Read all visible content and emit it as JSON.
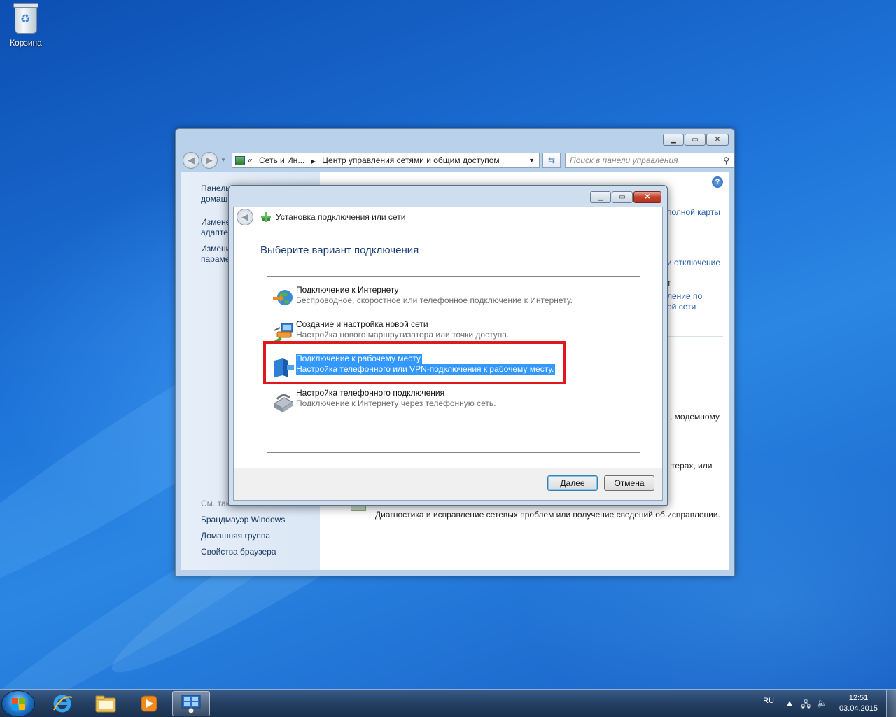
{
  "desktop": {
    "recycle_bin_label": "Корзина"
  },
  "control_panel": {
    "breadcrumb_chevron": "«",
    "breadcrumb_1": "Сеть и Ин...",
    "breadcrumb_arrow": "▶",
    "breadcrumb_2": "Центр управления сетями и общим доступом",
    "search_placeholder": "Поиск в панели управления",
    "left_items": [
      {
        "line1": "Панель",
        "line2": "домаш"
      },
      {
        "line1": "Измене",
        "line2": "адаптер"
      },
      {
        "line1": "Измени",
        "line2": "параме"
      }
    ],
    "see_also": "См. также",
    "see_also_items": [
      "Брандмауэр Windows",
      "Домашняя группа",
      "Свойства браузера"
    ],
    "right_fragments": {
      "f1": "полной карты",
      "f2": "и отключение",
      "f3": "т",
      "f4": "ление по",
      "f5": "ой сети",
      "f6": ", модемному",
      "f7": "терах, или",
      "f8": "Диагностика и исправление сетевых проблем или получение сведений об исправлении."
    }
  },
  "dialog": {
    "title": "Установка подключения или сети",
    "heading": "Выберите вариант подключения",
    "options": [
      {
        "title": "Подключение к Интернету",
        "desc": "Беспроводное, скоростное или телефонное подключение к Интернету."
      },
      {
        "title": "Создание и настройка новой сети",
        "desc": "Настройка нового маршрутизатора или точки доступа."
      },
      {
        "title": "Подключение к рабочему месту",
        "desc": "Настройка телефонного или VPN-подключения к рабочему месту."
      },
      {
        "title": "Настройка телефонного подключения",
        "desc": "Подключение к Интернету через телефонную сеть."
      }
    ],
    "selected_index": 2,
    "next_label": "Далее",
    "cancel_label": "Отмена"
  },
  "taskbar": {
    "language": "RU",
    "time": "12:51",
    "date": "03.04.2015",
    "pinned_icons": [
      "internet-explorer-icon",
      "explorer-folder-icon",
      "media-player-icon",
      "network-control-panel-icon"
    ]
  },
  "colors": {
    "selection": "#3399ff",
    "highlight_box": "#e0171f",
    "heading": "#1c3d7a"
  }
}
